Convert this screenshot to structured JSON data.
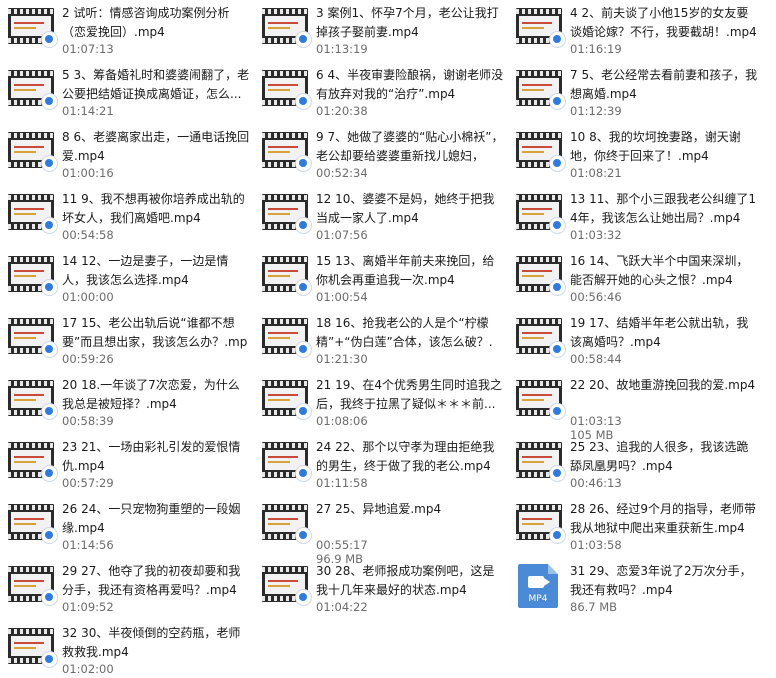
{
  "files": [
    {
      "name": "2 试听：情感咨询成功案例分析（恋爱挽回）.mp4",
      "meta": "01:07:13",
      "icon": "video-thumbnail-icon"
    },
    {
      "name": "3 案例1、怀孕7个月，老公让我打掉孩子娶前妻.mp4",
      "meta": "01:13:19",
      "icon": "video-thumbnail-icon"
    },
    {
      "name": "4 2、前夫谈了小他15岁的女友要谈婚论嫁？不行，我要截胡！.mp4",
      "meta": "01:16:19",
      "icon": "video-thumbnail-icon"
    },
    {
      "name": "5 3、筹备婚礼时和婆婆闹翻了，老公要把结婚证换成离婚证，怎么...",
      "meta": "01:14:21",
      "icon": "video-thumbnail-icon"
    },
    {
      "name": "6 4、半夜审妻险酿祸，谢谢老师没有放弃对我的“治疗”.mp4",
      "meta": "01:20:38",
      "icon": "video-thumbnail-icon"
    },
    {
      "name": "7 5、老公经常去看前妻和孩子，我想离婚.mp4",
      "meta": "01:12:39",
      "icon": "video-thumbnail-icon"
    },
    {
      "name": "8 6、老婆离家出走，一通电话挽回爱.mp4",
      "meta": "01:00:16",
      "icon": "video-thumbnail-icon"
    },
    {
      "name": "9 7、她做了婆婆的“贴心小棉袄”，老公却要给婆婆重新找儿媳妇，w...",
      "meta": "00:52:34",
      "icon": "video-thumbnail-icon"
    },
    {
      "name": "10 8、我的坎坷挽妻路，谢天谢地，你终于回来了！.mp4",
      "meta": "01:08:21",
      "icon": "video-thumbnail-icon"
    },
    {
      "name": "11 9、我不想再被你培养成出轨的坏女人，我们离婚吧.mp4",
      "meta": "00:54:58",
      "icon": "video-thumbnail-icon"
    },
    {
      "name": "12 10、婆婆不是妈，她终于把我当成一家人了.mp4",
      "meta": "01:07:56",
      "icon": "video-thumbnail-icon"
    },
    {
      "name": "13 11、那个小三跟我老公纠缠了14年，我该怎么让她出局？.mp4",
      "meta": "01:03:32",
      "icon": "video-thumbnail-icon"
    },
    {
      "name": "14 12、一边是妻子，一边是情人，我该怎么选择.mp4",
      "meta": "01:00:00",
      "icon": "video-thumbnail-icon"
    },
    {
      "name": "15 13、离婚半年前夫来挽回，给你机会再重追我一次.mp4",
      "meta": "01:00:54",
      "icon": "video-thumbnail-icon"
    },
    {
      "name": "16 14、飞跃大半个中国来深圳，能否解开她的心头之恨？.mp4",
      "meta": "00:56:46",
      "icon": "video-thumbnail-icon"
    },
    {
      "name": "17 15、老公出轨后说“谁都不想要”而且想出家，我该怎么办？.mp4",
      "meta": "00:59:26",
      "icon": "video-thumbnail-icon"
    },
    {
      "name": "18 16、抢我老公的人是个“柠檬精”+“伪白莲”合体，该怎么破？.mp4",
      "meta": "01:21:30",
      "icon": "video-thumbnail-icon"
    },
    {
      "name": "19 17、结婚半年老公就出轨，我该离婚吗？.mp4",
      "meta": "00:58:44",
      "icon": "video-thumbnail-icon"
    },
    {
      "name": "20 18.一年谈了7次恋爱，为什么我总是被短择？.mp4",
      "meta": "00:58:39",
      "icon": "video-thumbnail-icon"
    },
    {
      "name": "21 19、在4个优秀男生同时追我之后，我终于拉黑了疑似＊＊＊前...",
      "meta": "01:08:06",
      "icon": "video-thumbnail-icon"
    },
    {
      "name": "22 20、故地重游挽回我的爱.mp4",
      "meta": "01:03:13",
      "meta2": "105 MB",
      "icon": "video-thumbnail-icon"
    },
    {
      "name": "23 21、一场由彩礼引发的爱恨情仇.mp4",
      "meta": "00:57:29",
      "icon": "video-thumbnail-icon"
    },
    {
      "name": "24 22、那个以守孝为理由拒绝我的男生，终于做了我的老公.mp4",
      "meta": "01:11:58",
      "icon": "video-thumbnail-icon"
    },
    {
      "name": "25 23、追我的人很多，我该选跪舔凤凰男吗？.mp4",
      "meta": "00:46:13",
      "icon": "video-thumbnail-icon"
    },
    {
      "name": "26 24、一只宠物狗重塑的一段姻缘.mp4",
      "meta": "01:14:56",
      "icon": "video-thumbnail-icon"
    },
    {
      "name": "27 25、异地追爱.mp4",
      "meta": "00:55:17",
      "meta2": "96.9 MB",
      "icon": "video-thumbnail-icon"
    },
    {
      "name": "28 26、经过9个月的指导，老师带我从地狱中爬出来重获新生.mp4",
      "meta": "01:03:58",
      "icon": "video-thumbnail-icon"
    },
    {
      "name": "29 27、他夺了我的初夜却要和我分手，我还有资格再爱吗？.mp4",
      "meta": "01:09:52",
      "icon": "video-thumbnail-icon"
    },
    {
      "name": "30 28、老师报成功案例吧，这是我十几年来最好的状态.mp4",
      "meta": "01:04:22",
      "icon": "video-thumbnail-icon"
    },
    {
      "name": "31 29、恋爱3年说了2万次分手，我还有救吗？.mp4",
      "meta": "86.7 MB",
      "icon": "mp4-file-icon",
      "icon_label": "MP4"
    },
    {
      "name": "32 30、半夜倾倒的空药瓶，老师救救我.mp4",
      "meta": "01:02:00",
      "icon": "video-thumbnail-icon"
    }
  ]
}
